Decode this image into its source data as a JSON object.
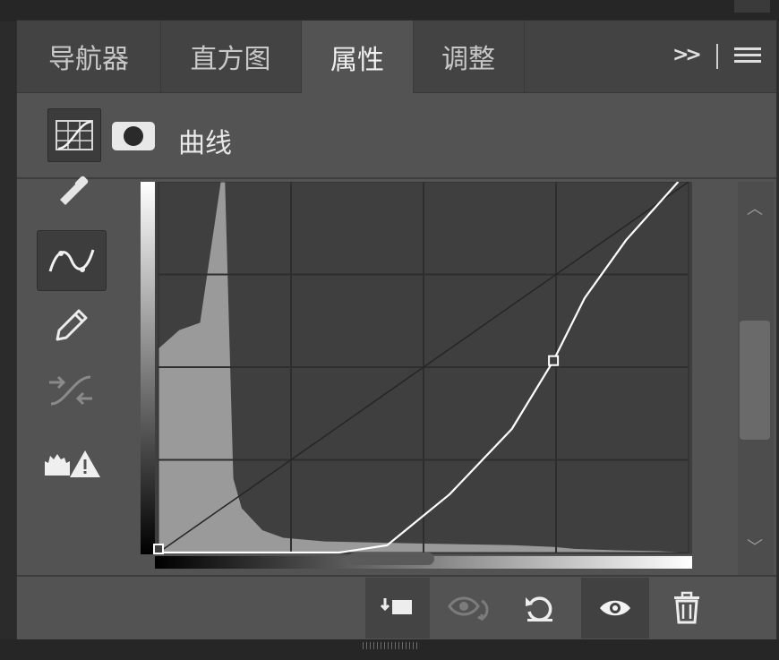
{
  "tabs": [
    {
      "label": "导航器",
      "active": false
    },
    {
      "label": "直方图",
      "active": false
    },
    {
      "label": "属性",
      "active": true
    },
    {
      "label": "调整",
      "active": false
    }
  ],
  "tabbar": {
    "more_label": ">>",
    "menu_icon": "hamburger-menu-icon"
  },
  "header": {
    "title": "曲线",
    "type_icon": "curves-adjustment-icon",
    "mask_icon": "layer-mask-icon"
  },
  "tools": [
    {
      "name": "eyedropper",
      "icon": "eyedropper-icon"
    },
    {
      "name": "edit-points",
      "icon": "curve-points-icon",
      "active": true
    },
    {
      "name": "draw-curve",
      "icon": "pencil-icon"
    },
    {
      "name": "smooth",
      "icon": "smooth-curve-icon",
      "disabled": true
    },
    {
      "name": "clipping-warning",
      "icon": "histogram-warning-icon"
    }
  ],
  "chart_data": {
    "type": "line",
    "title": "",
    "xlabel": "",
    "ylabel": "",
    "xlim": [
      0,
      255
    ],
    "ylim": [
      0,
      255
    ],
    "grid": "4x4",
    "series": [
      {
        "x": [
          0,
          87,
          110,
          140,
          170,
          190,
          205,
          225,
          250
        ],
        "y": [
          0,
          0,
          5,
          40,
          85,
          132,
          175,
          215,
          255
        ]
      }
    ],
    "control_points": [
      {
        "x": 0,
        "y": 0
      },
      {
        "x": 190,
        "y": 132
      }
    ],
    "baseline": {
      "x": [
        0,
        255
      ],
      "y": [
        0,
        255
      ]
    },
    "histogram": {
      "x": [
        0,
        10,
        20,
        30,
        32,
        34,
        36,
        40,
        50,
        60,
        80,
        120,
        170,
        190,
        200,
        220,
        240,
        255
      ],
      "y": [
        0.55,
        0.6,
        0.62,
        1.0,
        1.0,
        0.6,
        0.2,
        0.12,
        0.06,
        0.04,
        0.03,
        0.025,
        0.02,
        0.015,
        0.01,
        0.006,
        0.004,
        0.0
      ]
    }
  },
  "bottom": [
    {
      "name": "clip-to-layer",
      "icon": "clip-to-layer-icon"
    },
    {
      "name": "view-previous",
      "icon": "view-previous-state-icon",
      "disabled": true
    },
    {
      "name": "reset",
      "icon": "reset-icon"
    },
    {
      "name": "visibility",
      "icon": "eye-icon"
    },
    {
      "name": "delete",
      "icon": "trash-icon"
    }
  ],
  "colors": {
    "panel": "#535353",
    "tabbar": "#434343",
    "graph_bg": "#3e3e3e",
    "histogram": "#9a9a9a",
    "curve": "#ffffff"
  }
}
